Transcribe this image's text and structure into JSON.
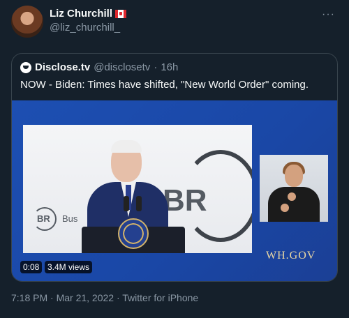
{
  "author": {
    "display_name": "Liz Churchill",
    "flag_icon": "canada-flag-icon",
    "handle": "@liz_churchill_",
    "more_icon": "more-icon",
    "more_label": "···"
  },
  "quoted": {
    "source_icon": "disclose-logo-icon",
    "name": "Disclose.tv",
    "handle": "@disclosetv",
    "separator": "·",
    "age": "16h",
    "text": "NOW - Biden: Times have shifted, \"New World Order\" coming.",
    "video": {
      "stage_logo_big": "BR",
      "stage_logo_small": "BR",
      "stage_partial_text": "Bus",
      "watermark": "WH.GOV",
      "duration": "0:08",
      "views": "3.4M views"
    }
  },
  "meta": {
    "text": "7:18 PM · Mar 21, 2022 · Twitter for iPhone"
  },
  "colors": {
    "background": "#15202b",
    "border": "#38444d",
    "secondary_text": "#8b98a5",
    "video_blue": "#1d4fb2"
  }
}
